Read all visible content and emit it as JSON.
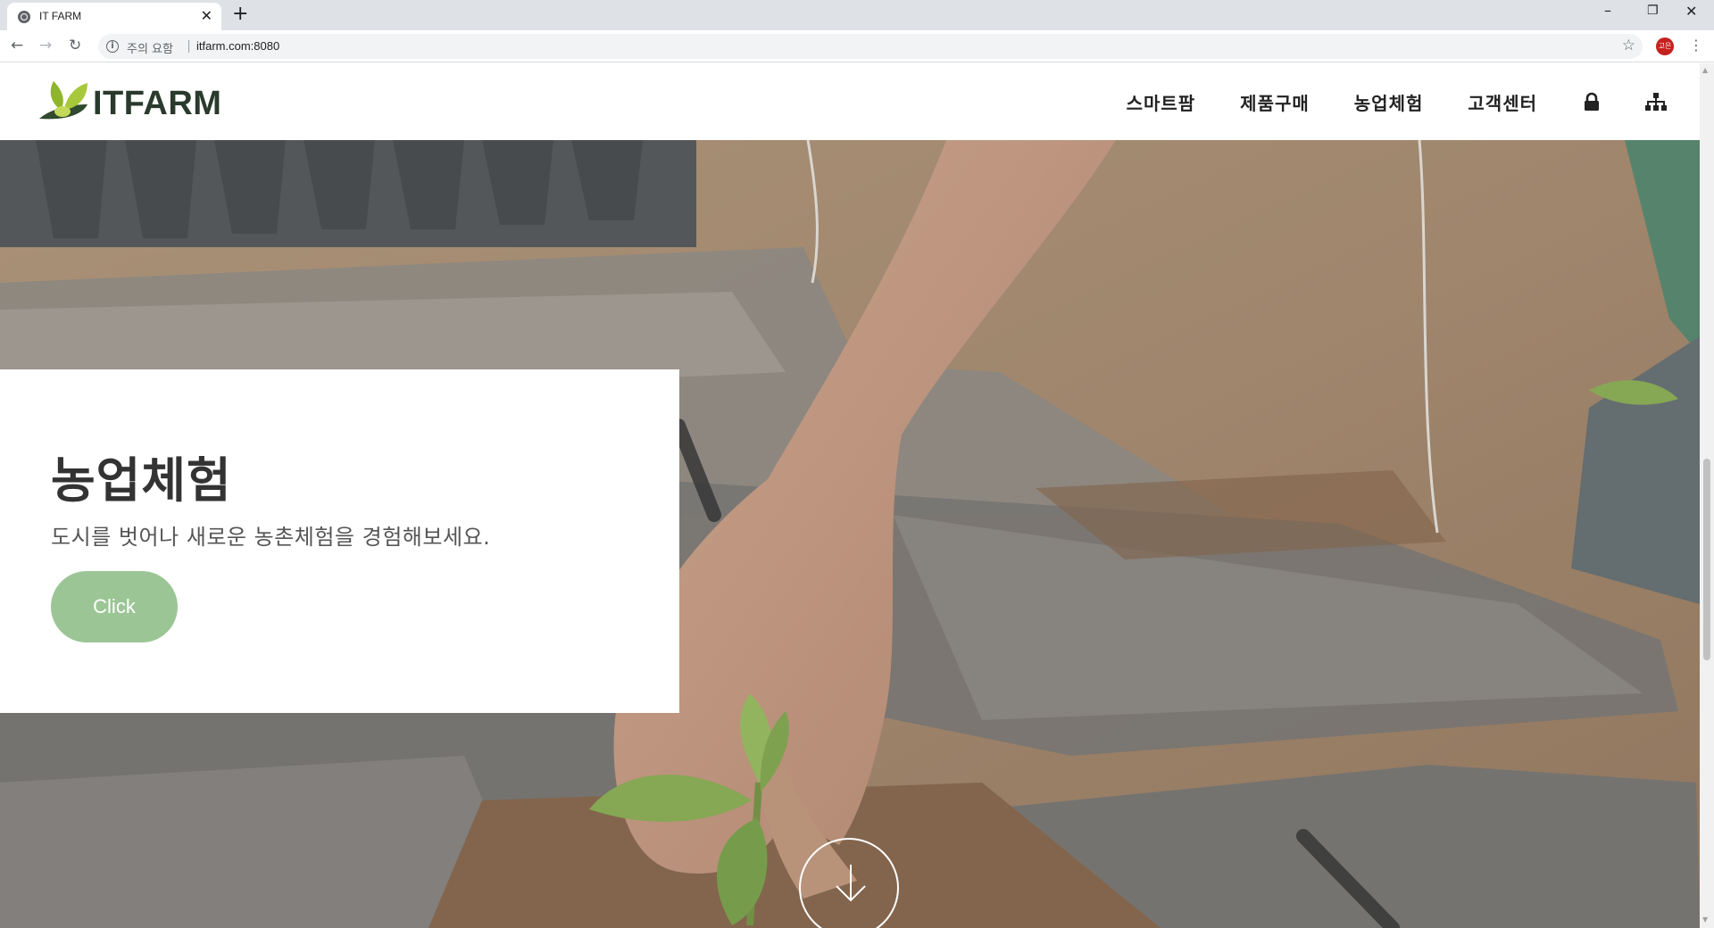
{
  "browser": {
    "tab_title": "IT FARM",
    "security_label": "주의 요함",
    "url": "itfarm.com:8080",
    "profile_initials": "고은"
  },
  "site": {
    "logo_text": "ITFARM",
    "nav": {
      "items": [
        {
          "label": "스마트팜"
        },
        {
          "label": "제품구매"
        },
        {
          "label": "농업체험"
        },
        {
          "label": "고객센터"
        }
      ],
      "icons": [
        "lock-icon",
        "sitemap-icon"
      ]
    }
  },
  "hero": {
    "title": "농업체험",
    "subtitle": "도시를 벗어나 새로운 농촌체험을 경험해보세요.",
    "button_label": "Click"
  },
  "colors": {
    "accent_green": "#9bc595",
    "logo_leaf": "#8fb62a",
    "logo_dark": "#2a3a2c"
  }
}
